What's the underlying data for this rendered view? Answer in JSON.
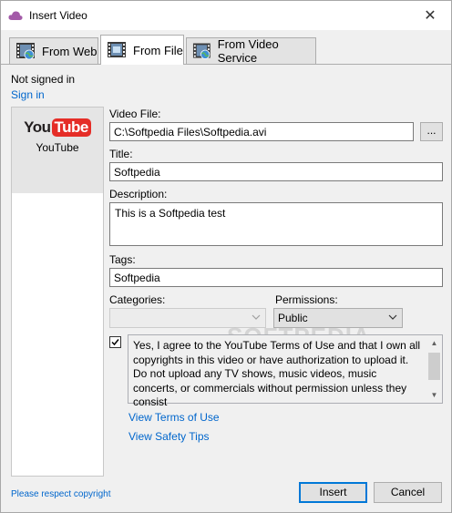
{
  "window": {
    "title": "Insert Video",
    "close_glyph": "✕"
  },
  "tabs": [
    {
      "label": "From Web",
      "icon": "film-globe-icon",
      "active": false
    },
    {
      "label": "From File",
      "icon": "film-file-icon",
      "active": true
    },
    {
      "label": "From Video Service",
      "icon": "film-globe-icon",
      "active": false
    }
  ],
  "account": {
    "status": "Not signed in",
    "sign_in_label": "Sign in"
  },
  "services": [
    {
      "logo_you": "You",
      "logo_tube": "Tube",
      "name": "YouTube",
      "selected": true
    }
  ],
  "form": {
    "video_file_label": "Video File:",
    "video_file_value": "C:\\Softpedia Files\\Softpedia.avi",
    "browse_label": "...",
    "title_label": "Title:",
    "title_value": "Softpedia",
    "description_label": "Description:",
    "description_value": "This is a Softpedia test",
    "tags_label": "Tags:",
    "tags_value": "Softpedia",
    "categories_label": "Categories:",
    "categories_value": "",
    "permissions_label": "Permissions:",
    "permissions_value": "Public",
    "terms_checked": true,
    "terms_text": "Yes, I agree to the YouTube Terms of Use and that I own all copyrights in this video or have authorization to upload it. Do not upload any TV shows, music videos, music concerts, or commercials without permission unless they consist"
  },
  "links": {
    "terms_of_use": "View Terms of Use",
    "safety_tips": "View Safety Tips"
  },
  "footer": {
    "note": "Please respect copyright",
    "insert_label": "Insert",
    "cancel_label": "Cancel"
  },
  "watermark": "SOFTPEDIA",
  "colors": {
    "link": "#0066cc",
    "youtube_red": "#e52d27",
    "primary_border": "#0078d7"
  }
}
